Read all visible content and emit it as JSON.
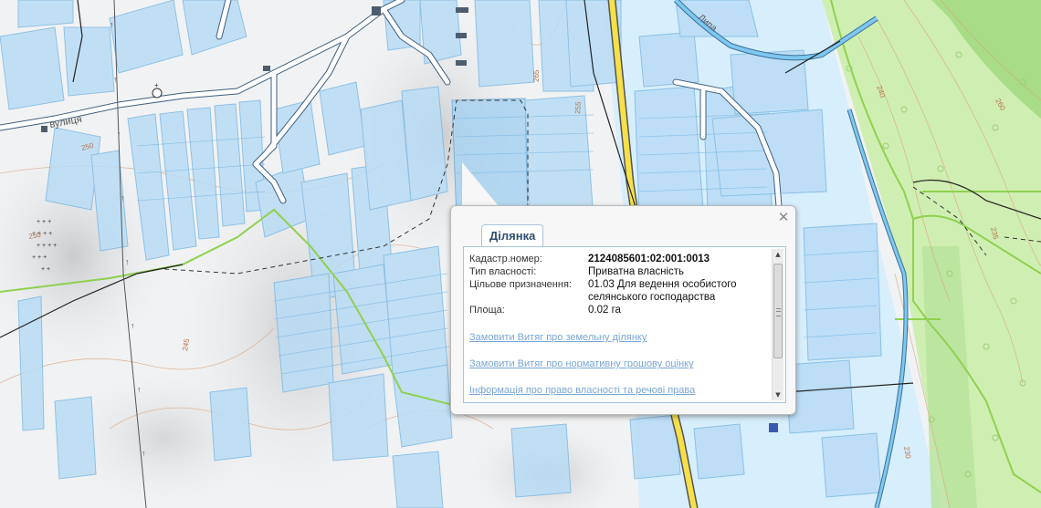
{
  "map": {
    "street_label": "вулиця",
    "river_label": "Липа",
    "contour_labels": [
      "250",
      "255",
      "240",
      "260",
      "235",
      "230",
      "245",
      "265",
      "250"
    ],
    "colors": {
      "parcel_fill": "#b9dcf5",
      "parcel_stroke": "#7cb9e4",
      "road": "#ffffff",
      "road_casing": "#3f5f7f",
      "main_road": "#f6e04a",
      "boundary_green": "#8fd14f",
      "forest": "#c8ecaa",
      "contour": "#d79a6e"
    }
  },
  "popup": {
    "tab_label": "Ділянка",
    "close_icon": "close-icon",
    "fields": [
      {
        "key": "Кадастр.номер:",
        "value": "2124085601:02:001:0013",
        "bold": true
      },
      {
        "key": "Тип власності:",
        "value": "Приватна власність",
        "bold": false
      },
      {
        "key": "Цільове призначення:",
        "value": "01.03 Для ведення особистого селянського господарства",
        "bold": false
      },
      {
        "key": "Площа:",
        "value": "0.02 га",
        "bold": false
      }
    ],
    "links": [
      "Замовити Витяг про земельну ділянку",
      "Замовити Витяг про нормативну грошову оцінку",
      "Інформація про право власності та речові права"
    ]
  }
}
